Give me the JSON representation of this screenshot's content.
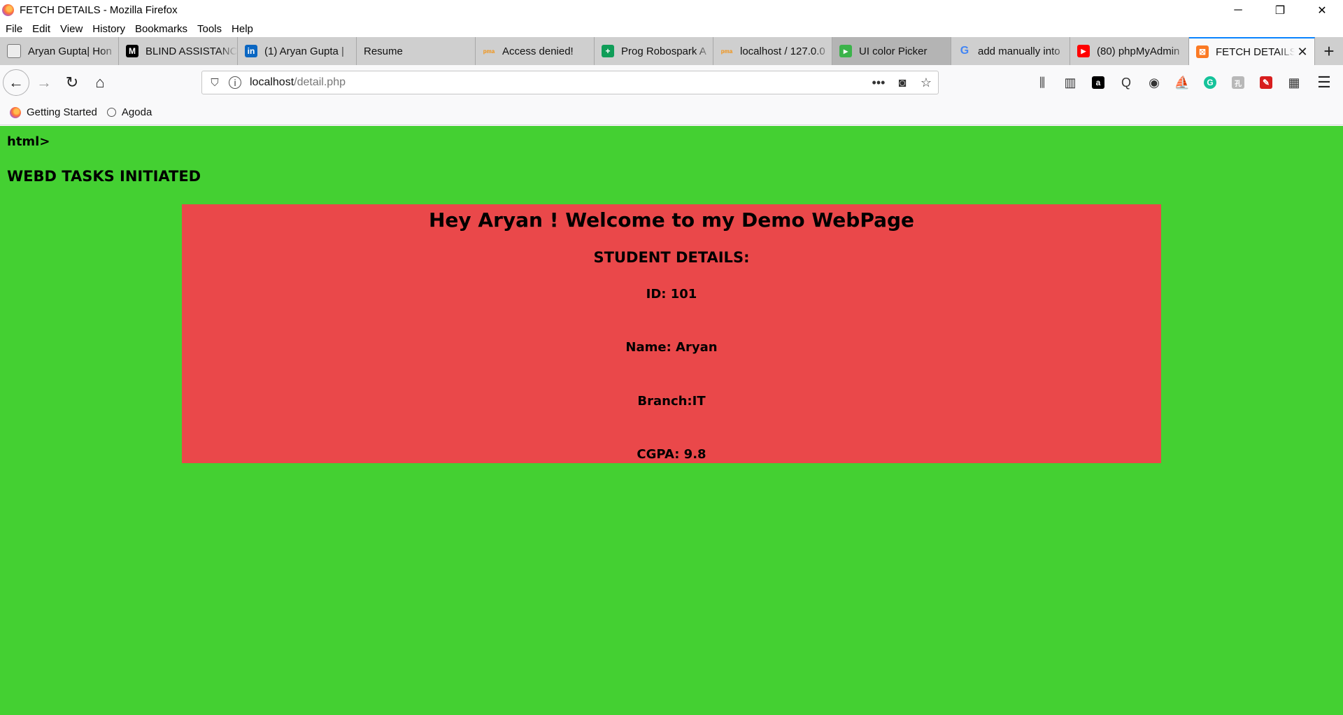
{
  "window": {
    "title": "FETCH DETAILS - Mozilla Firefox",
    "controls": {
      "minimize": "─",
      "restore": "❐",
      "close": "✕"
    }
  },
  "menubar": {
    "items": [
      "File",
      "Edit",
      "View",
      "History",
      "Bookmarks",
      "Tools",
      "Help"
    ]
  },
  "tabs": [
    {
      "label": "Aryan Gupta| Hon",
      "icon": "page-icon",
      "color": "#5c5c5c",
      "glyph": ""
    },
    {
      "label": "BLIND ASSISTANC",
      "icon": "medium-icon",
      "color": "#000000",
      "glyph": "M"
    },
    {
      "label": "(1) Aryan Gupta |",
      "icon": "linkedin-icon",
      "color": "#0a66c2",
      "glyph": "in"
    },
    {
      "label": "Resume",
      "icon": "",
      "color": "",
      "glyph": ""
    },
    {
      "label": "Access denied!",
      "icon": "phpmyadmin-icon",
      "color": "#f29111",
      "glyph": "pma"
    },
    {
      "label": "Prog Robospark A",
      "icon": "sheets-icon",
      "color": "#0f9d58",
      "glyph": "+"
    },
    {
      "label": "localhost / 127.0.0",
      "icon": "phpmyadmin-icon",
      "color": "#f29111",
      "glyph": "pma"
    },
    {
      "label": "UI color Picker",
      "icon": "colorpicker-icon",
      "color": "#3bb34a",
      "glyph": "▸"
    },
    {
      "label": "add manually into",
      "icon": "google-icon",
      "color": "#4285f4",
      "glyph": "G"
    },
    {
      "label": "(80) phpMyAdmin",
      "icon": "youtube-icon",
      "color": "#ff0000",
      "glyph": "▶"
    },
    {
      "label": "FETCH DETAILS",
      "icon": "xampp-icon",
      "color": "#fb7a24",
      "glyph": "⊠"
    }
  ],
  "newtab": "+",
  "nav": {
    "back": "←",
    "forward": "→",
    "reload": "↻",
    "home": "⌂",
    "url_host": "localhost",
    "url_path": "/detail.php",
    "page_actions": "•••",
    "pocket": "◙",
    "bookmark_star": "☆",
    "menu": "☰"
  },
  "extensions": [
    {
      "name": "library-icon",
      "glyph": "⫼",
      "color": "#333333"
    },
    {
      "name": "sidebar-icon",
      "glyph": "▥",
      "color": "#333333"
    },
    {
      "name": "amazon-icon",
      "glyph": "a",
      "color": "#000000"
    },
    {
      "name": "search-ext-icon",
      "glyph": "Q",
      "color": "#333333"
    },
    {
      "name": "account-icon",
      "glyph": "◉",
      "color": "#333333"
    },
    {
      "name": "ship-icon",
      "glyph": "⛵",
      "color": "#777777"
    },
    {
      "name": "grammarly-icon",
      "glyph": "G",
      "color": "#15c39a"
    },
    {
      "name": "translate-icon",
      "glyph": "孔",
      "color": "#9a9a9a"
    },
    {
      "name": "wand-icon",
      "glyph": "✎",
      "color": "#d81e1e"
    },
    {
      "name": "fence-icon",
      "glyph": "▦",
      "color": "#333333"
    }
  ],
  "bookmarks": [
    {
      "label": "Getting Started",
      "icon": "firefox-icon"
    },
    {
      "label": "Agoda",
      "icon": "agoda-icon"
    }
  ],
  "page": {
    "html_text": "html>",
    "heading": "WEBD TASKS INITIATED",
    "welcome": "Hey Aryan ! Welcome to my Demo WebPage",
    "section_title": "STUDENT DETAILS:",
    "id_line": "ID: 101",
    "name_line": "Name: Aryan",
    "branch_line": "Branch:IT",
    "cgpa_line": "CGPA: 9.8",
    "bg_color": "#44d032",
    "panel_color": "#ea484a"
  }
}
